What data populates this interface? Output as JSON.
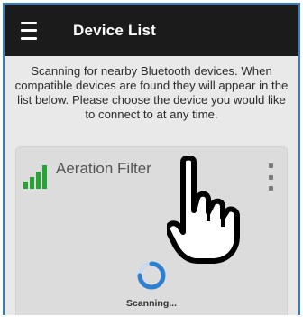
{
  "app": {
    "title": "Device List"
  },
  "header": {
    "menu_icon": "hamburger-menu-icon"
  },
  "intro_text": "Scanning for nearby Bluetooth devices. When compatible devices are found they will appear in the list below. Please choose the device you would like to connect to at any time.",
  "devices": [
    {
      "name": "Aeration Filter",
      "signal_icon": "signal-strength-icon",
      "signal_level": "4 of 4 bars",
      "menu_icon": "more-vert-icon"
    }
  ],
  "status": {
    "label": "Scanning..."
  },
  "overlay": {
    "icon": "pointing-hand-icon"
  },
  "colors": {
    "appbar": "#1b1b1b",
    "signal": "#26a334",
    "frame_border": "#2a7fd0",
    "spinner": "#2f7fcf"
  }
}
